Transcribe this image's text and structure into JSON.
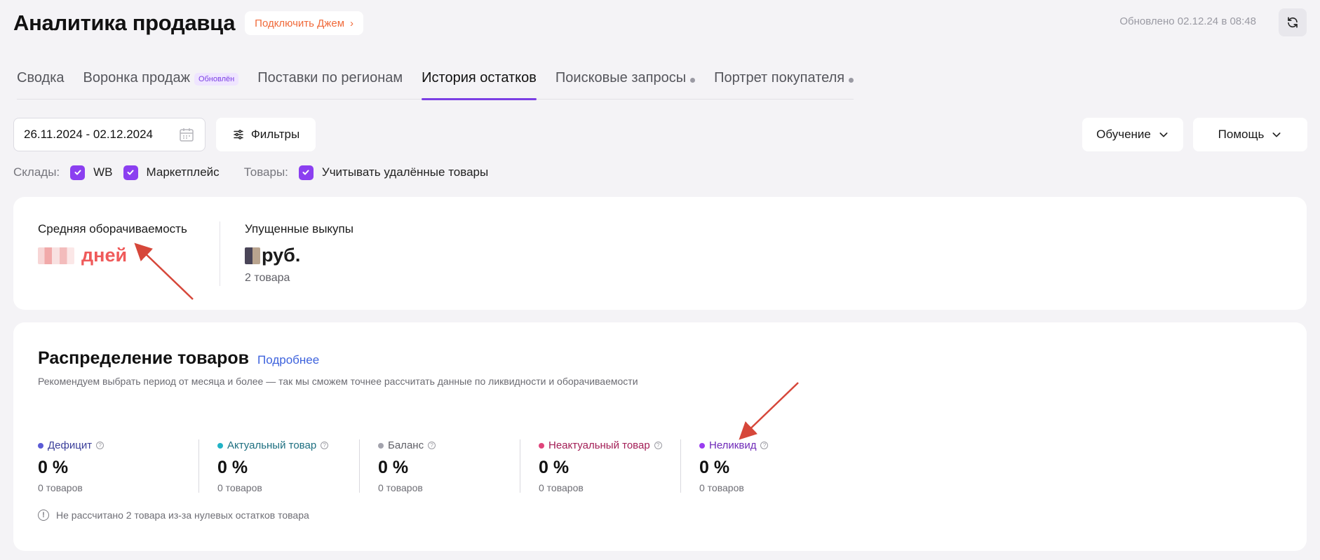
{
  "header": {
    "title": "Аналитика продавца",
    "promo_label": "Подключить Джем",
    "updated_text": "Обновлено 02.12.24 в 08:48"
  },
  "tabs": [
    {
      "label": "Сводка",
      "badge": "",
      "dot": false,
      "active": false
    },
    {
      "label": "Воронка продаж",
      "badge": "Обновлён",
      "dot": false,
      "active": false
    },
    {
      "label": "Поставки по регионам",
      "badge": "",
      "dot": false,
      "active": false
    },
    {
      "label": "История остатков",
      "badge": "",
      "dot": false,
      "active": true
    },
    {
      "label": "Поисковые запросы",
      "badge": "",
      "dot": true,
      "active": false
    },
    {
      "label": "Портрет покупателя",
      "badge": "",
      "dot": true,
      "active": false
    }
  ],
  "toolbar": {
    "date_range": "26.11.2024 - 02.12.2024",
    "filters_label": "Фильтры",
    "learn_label": "Обучение",
    "help_label": "Помощь"
  },
  "checkboxes": {
    "warehouses_label": "Склады:",
    "wb_label": "WB",
    "marketplace_label": "Маркетплейс",
    "goods_label": "Товары:",
    "deleted_label": "Учитывать удалённые товары"
  },
  "summary": {
    "turnover_label": "Средняя оборачиваемость",
    "turnover_unit": "дней",
    "missed_label": "Упущенные выкупы",
    "missed_unit": "руб.",
    "missed_sub": "2 товара"
  },
  "distribution": {
    "title": "Распределение товаров",
    "more_link": "Подробнее",
    "description": "Рекомендуем выбрать период от месяца и более — так мы сможем точнее рассчитать данные по ликвидности и оборачиваемости",
    "stats": [
      {
        "label": "Дефицит",
        "color": "#5b5bd6",
        "text_color": "#3b3f9a",
        "value": "0 %",
        "sub": "0 товаров"
      },
      {
        "label": "Актуальный товар",
        "color": "#21b3c6",
        "text_color": "#1d6f80",
        "value": "0 %",
        "sub": "0 товаров"
      },
      {
        "label": "Баланс",
        "color": "#a3a3ad",
        "text_color": "#5f5f66",
        "value": "0 %",
        "sub": "0 товаров"
      },
      {
        "label": "Неактуальный товар",
        "color": "#e0457b",
        "text_color": "#a31e56",
        "value": "0 %",
        "sub": "0 товаров"
      },
      {
        "label": "Неликвид",
        "color": "#9a3cf0",
        "text_color": "#6f2ab8",
        "value": "0 %",
        "sub": "0 товаров"
      }
    ],
    "note": "Не рассчитано 2 товара из-за нулевых остатков товара"
  }
}
